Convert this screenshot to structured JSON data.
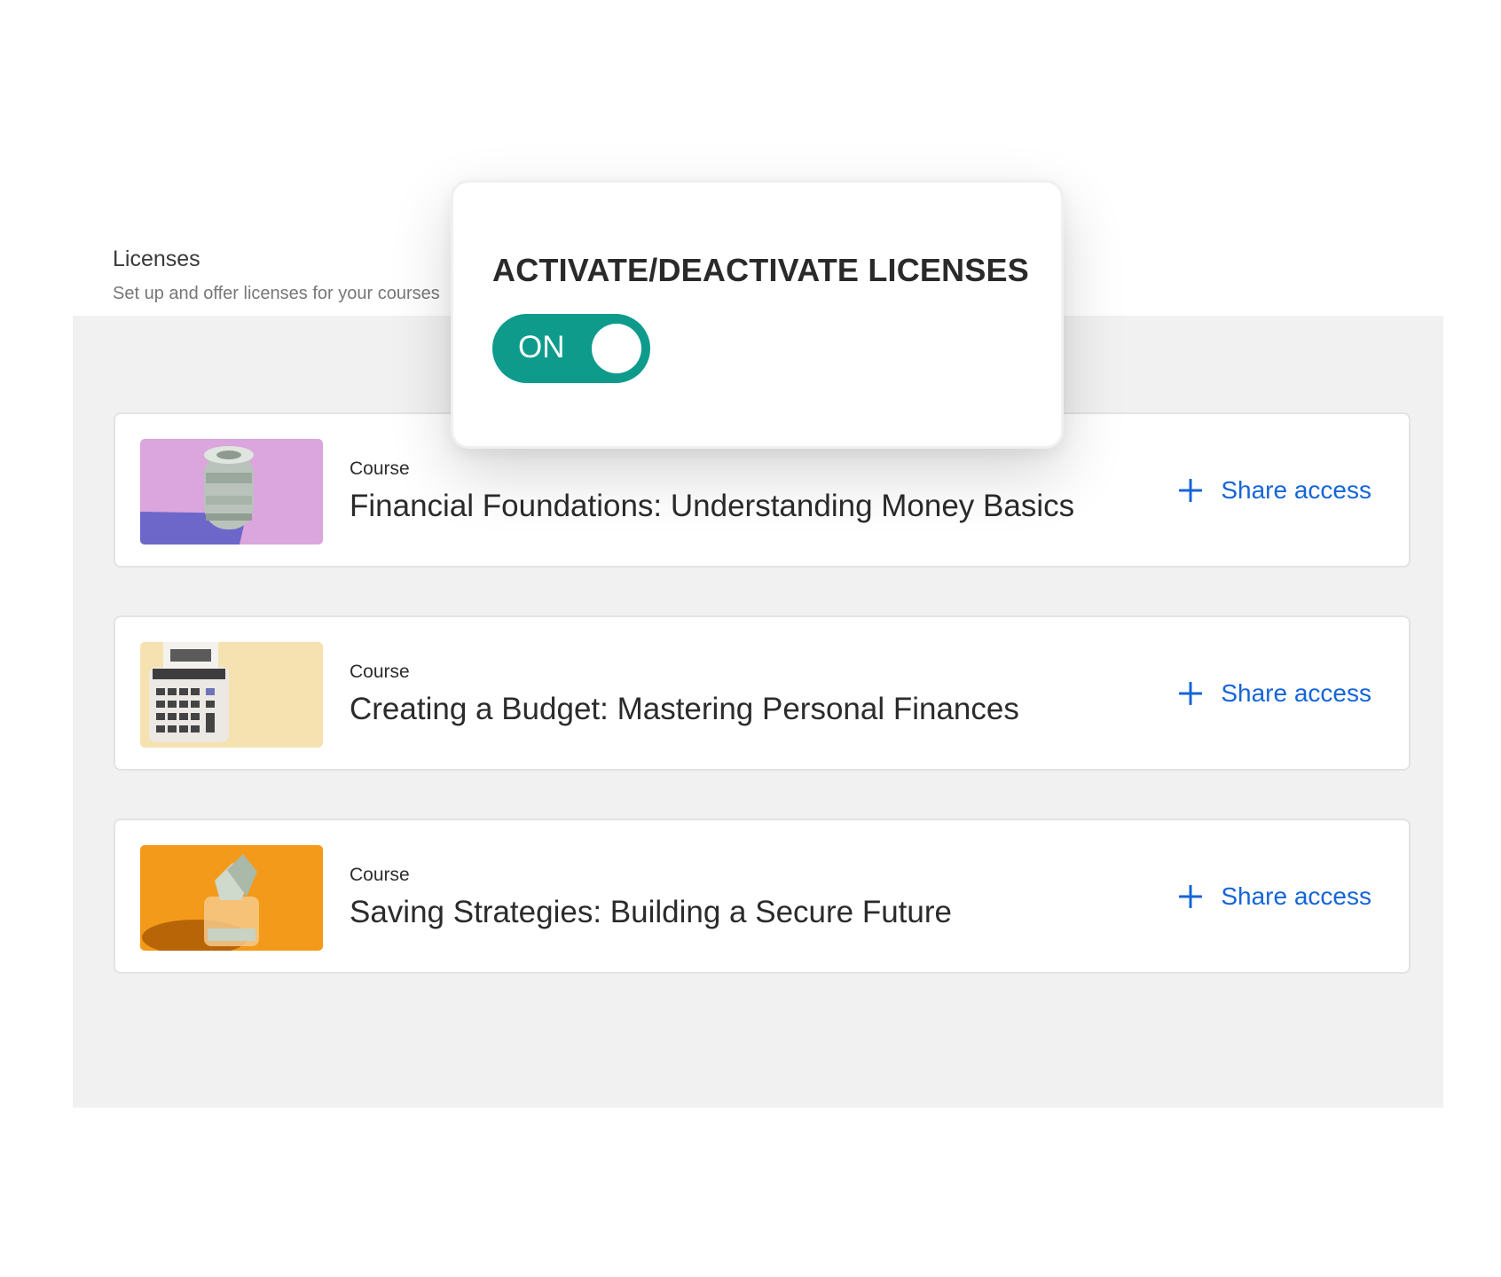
{
  "header": {
    "title": "Licenses",
    "subtitle": "Set up and offer licenses for your courses"
  },
  "modal": {
    "title": "ACTIVATE/DEACTIVATE LICENSES",
    "toggle": {
      "label": "ON",
      "state": "on",
      "color": "#0e9b8c"
    }
  },
  "courses": [
    {
      "label": "Course",
      "title": "Financial Foundations: Understanding Money Basics",
      "share_label": "Share access",
      "thumbnail_icon": "money-roll-icon",
      "thumbnail_color": "#dba5dd"
    },
    {
      "label": "Course",
      "title": "Creating a Budget: Mastering Personal Finances",
      "share_label": "Share access",
      "thumbnail_icon": "calculator-icon",
      "thumbnail_color": "#f5e2b0"
    },
    {
      "label": "Course",
      "title": "Saving Strategies: Building a Secure Future",
      "share_label": "Share access",
      "thumbnail_icon": "money-jar-icon",
      "thumbnail_color": "#f39a1a"
    }
  ],
  "colors": {
    "link": "#1565d8",
    "panel_background": "#f1f1f1",
    "toggle_on": "#0e9b8c"
  }
}
